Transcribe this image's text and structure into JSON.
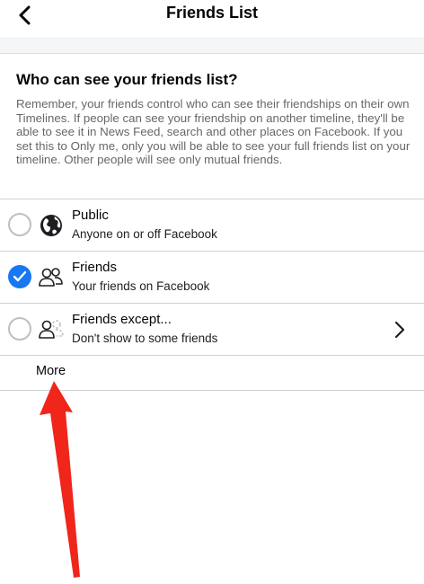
{
  "header": {
    "title": "Friends List",
    "back_icon": "chevron-left-icon"
  },
  "section": {
    "heading": "Who can see your friends list?",
    "description": "Remember, your friends control who can see their friendships on their own Timelines. If people can see your friendship on another timeline, they'll be able to see it in News Feed, search and other places on Facebook. If you set this to Only me, only you will be able to see your full friends list on your timeline. Other people will see only mutual friends."
  },
  "options": [
    {
      "title": "Public",
      "subtitle": "Anyone on or off Facebook",
      "icon": "globe-icon",
      "selected": false
    },
    {
      "title": "Friends",
      "subtitle": "Your friends on Facebook",
      "icon": "friends-icon",
      "selected": true
    },
    {
      "title": "Friends except...",
      "subtitle": "Don't show to some friends",
      "icon": "friends-except-icon",
      "selected": false
    }
  ],
  "more_label": "More",
  "colors": {
    "accent": "#1877f2",
    "annotation_arrow": "#f0261b",
    "secondary_text": "#65676b"
  }
}
